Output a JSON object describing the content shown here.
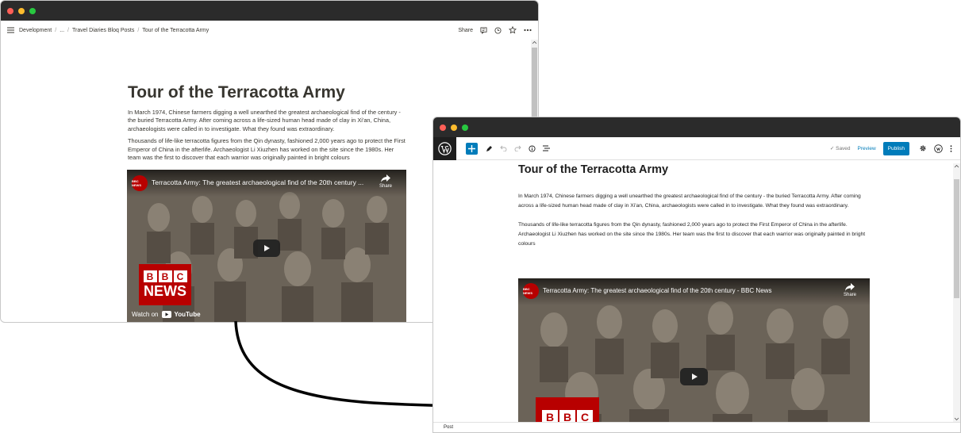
{
  "notion": {
    "breadcrumbs": [
      "Development",
      "...",
      "Travel Diaries Bloq Posts",
      "Tour of the Terracotta Army"
    ],
    "share_label": "Share",
    "page_title": "Tour of the Terracotta Army",
    "paragraphs": [
      "In March 1974, Chinese farmers digging a well unearthed the greatest archaeological find of the century - the buried Terracotta Army.  After coming across a life-sized human head made of clay in Xi'an, China, archaeologists were called in to investigate.  What they found was extraordinary.",
      "Thousands of life-like terracotta figures from the Qin dynasty, fashioned 2,000 years ago to protect the First Emperor of China in the afterlife.  Archaeologist Li Xiuzhen has worked on the site since the 1980s.  Her team was the first to discover that each warrior was originally painted in bright colours"
    ],
    "video": {
      "title": "Terracotta Army: The greatest archaeological find of the 20th century ...",
      "channel_badge": "BBC NEWS",
      "share_label": "Share",
      "watch_on": "Watch on",
      "youtube": "YouTube",
      "bbc": "BBC",
      "news": "NEWS"
    }
  },
  "wordpress": {
    "status_saved": "✓ Saved",
    "preview_label": "Preview",
    "publish_label": "Publish",
    "post_title": "Tour of the Terracotta Army",
    "paragraphs": [
      "In March 1974, Chinese farmers digging a well unearthed the greatest archaeological find of the century - the buried Terracotta Army.  After coming across a life-sized human head made of clay in Xi'an, China, archaeologists were called in to investigate.  What they found was extraordinary.",
      "Thousands of life-like terracotta figures from the Qin dynasty, fashioned 2,000 years ago to protect the First Emperor of China in the afterlife.  Archaeologist Li Xiuzhen has worked on the site since the 1980s.  Her team was the first to discover that each warrior was originally painted in bright colours"
    ],
    "video": {
      "title": "Terracotta Army: The greatest archaeological find of the 20th century - BBC News",
      "channel_badge": "BBC NEWS",
      "share_label": "Share",
      "bbc": "BBC"
    },
    "footer_label": "Post"
  },
  "colors": {
    "close": "#ff5f57",
    "minimize": "#febc2e",
    "zoom": "#28c840",
    "wp_blue": "#007cba",
    "bbc_red": "#b80000"
  }
}
